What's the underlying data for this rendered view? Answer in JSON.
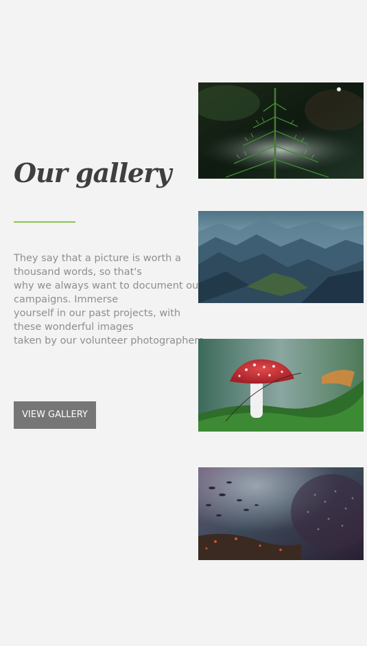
{
  "gallery": {
    "title": "Our gallery",
    "description_lines": [
      "They say that a picture is worth a",
      "thousand words, so that's",
      "why we always want to document our",
      "campaigns. Immerse",
      "yourself in our past projects, with",
      "these wonderful images",
      "taken by our volunteer photographers."
    ],
    "button_label": "VIEW GALLERY",
    "accent_color": "#8bc34a",
    "button_color": "#767676",
    "photos": [
      {
        "subject": "pine-sapling-photo"
      },
      {
        "subject": "misty-mountains-photo"
      },
      {
        "subject": "red-mushroom-photo"
      },
      {
        "subject": "underwater-fish-school-photo"
      }
    ]
  }
}
